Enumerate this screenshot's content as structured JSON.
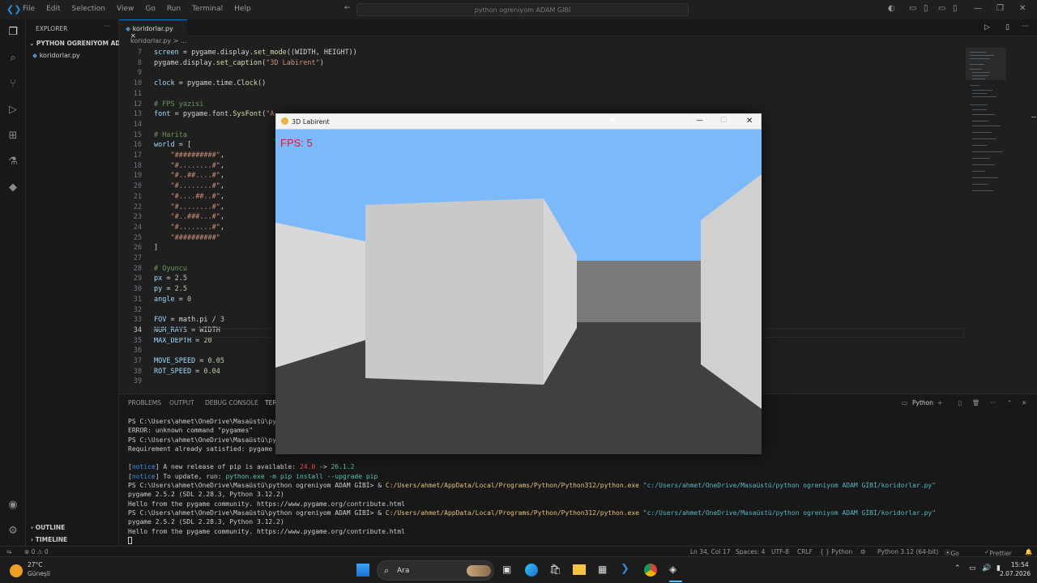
{
  "titlebar": {
    "menu": [
      "File",
      "Edit",
      "Selection",
      "View",
      "Go",
      "Run",
      "Terminal",
      "Help"
    ],
    "search": "python ogreniyom ADAM GİBİ"
  },
  "sidebar": {
    "header": "EXPLORER",
    "folder": "PYTHON OGRENIYOM AD...",
    "file": "koridorlar.py",
    "outline": "OUTLINE",
    "timeline": "TIMELINE"
  },
  "editor": {
    "tab": "koridorlar.py",
    "breadcrumb": "koridorlar.py > ...",
    "lines": [
      {
        "n": "7",
        "t": "screen = pygame.display.set_mode((WIDTH, HEIGHT))"
      },
      {
        "n": "8",
        "t": "pygame.display.set_caption(\"3D Labirent\")"
      },
      {
        "n": "9",
        "t": ""
      },
      {
        "n": "10",
        "t": "clock = pygame.time.Clock()"
      },
      {
        "n": "11",
        "t": ""
      },
      {
        "n": "12",
        "t": "# FPS yazisi"
      },
      {
        "n": "13",
        "t": "font = pygame.font.SysFont(\"A"
      },
      {
        "n": "14",
        "t": ""
      },
      {
        "n": "15",
        "t": "# Harita"
      },
      {
        "n": "16",
        "t": "world = ["
      },
      {
        "n": "17",
        "t": "    \"##########\","
      },
      {
        "n": "18",
        "t": "    \"#........#\","
      },
      {
        "n": "19",
        "t": "    \"#..##....#\","
      },
      {
        "n": "20",
        "t": "    \"#........#\","
      },
      {
        "n": "21",
        "t": "    \"#....##..#\","
      },
      {
        "n": "22",
        "t": "    \"#........#\","
      },
      {
        "n": "23",
        "t": "    \"#..###...#\","
      },
      {
        "n": "24",
        "t": "    \"#........#\","
      },
      {
        "n": "25",
        "t": "    \"##########\""
      },
      {
        "n": "26",
        "t": "]"
      },
      {
        "n": "27",
        "t": ""
      },
      {
        "n": "28",
        "t": "# Oyuncu"
      },
      {
        "n": "29",
        "t": "px = 2.5"
      },
      {
        "n": "30",
        "t": "py = 2.5"
      },
      {
        "n": "31",
        "t": "angle = 0"
      },
      {
        "n": "32",
        "t": ""
      },
      {
        "n": "33",
        "t": "FOV = math.pi / 3"
      },
      {
        "n": "34",
        "t": "NUM_RAYS = WIDTH"
      },
      {
        "n": "35",
        "t": "MAX_DEPTH = 20"
      },
      {
        "n": "36",
        "t": ""
      },
      {
        "n": "37",
        "t": "MOVE_SPEED = 0.05"
      },
      {
        "n": "38",
        "t": "ROT_SPEED = 0.04"
      },
      {
        "n": "39",
        "t": ""
      }
    ]
  },
  "panel": {
    "tabs": [
      "PROBLEMS",
      "OUTPUT",
      "DEBUG CONSOLE",
      "TERI"
    ],
    "shell": "Python",
    "terminal": [
      "PS C:\\Users\\ahmet\\OneDrive\\Masaüstü\\pyt",
      "ERROR: unknown command \"pygames\"",
      "PS C:\\Users\\ahmet\\OneDrive\\Masaüstü\\pyt",
      "Requirement already satisfied: pygame i",
      "",
      "[notice] A new release of pip is available: 24.0 -> 26.1.2",
      "[notice] To update, run: python.exe -m pip install --upgrade pip",
      "PS C:\\Users\\ahmet\\OneDrive\\Masaüstü\\python ogreniyom ADAM GİBİ> & C:/Users/ahmet/AppData/Local/Programs/Python/Python312/python.exe \"c:/Users/ahmet/OneDrive/Masaüstü/python ogreniyom ADAM GİBİ/koridorlar.py\"",
      "pygame 2.5.2 (SDL 2.28.3, Python 3.12.2)",
      "Hello from the pygame community. https://www.pygame.org/contribute.html",
      "PS C:\\Users\\ahmet\\OneDrive\\Masaüstü\\python ogreniyom ADAM GİBİ> & C:/Users/ahmet/AppData/Local/Programs/Python/Python312/python.exe \"c:/Users/ahmet/OneDrive/Masaüstü/python ogreniyom ADAM GİBİ/koridorlar.py\"",
      "pygame 2.5.2 (SDL 2.28.3, Python 3.12.2)",
      "Hello from the pygame community. https://www.pygame.org/contribute.html"
    ]
  },
  "status": {
    "errors": "⊗ 0 ⚠ 0",
    "position": "Ln 34, Col 17",
    "spaces": "Spaces: 4",
    "encoding": "UTF-8",
    "eol": "CRLF",
    "lang": "{ } Python",
    "interpreter": "Python 3.12 (64-bit)",
    "golive": "Go Live",
    "prettier": "Prettier"
  },
  "pygame": {
    "title": "3D Labirent",
    "fps": "FPS: 5",
    "colors": {
      "sky": "#7cb9fb",
      "floor": "#404040",
      "wall_light": "#d4d4d4",
      "wall_mid": "#c8c8c8",
      "wall_dark": "#7a7a7a",
      "fps": "#e0182d"
    }
  },
  "taskbar": {
    "weather_temp": "27°C",
    "weather_desc": "Güneşli",
    "search": "Ara",
    "time": "15:54",
    "date": "2.07.2026"
  }
}
